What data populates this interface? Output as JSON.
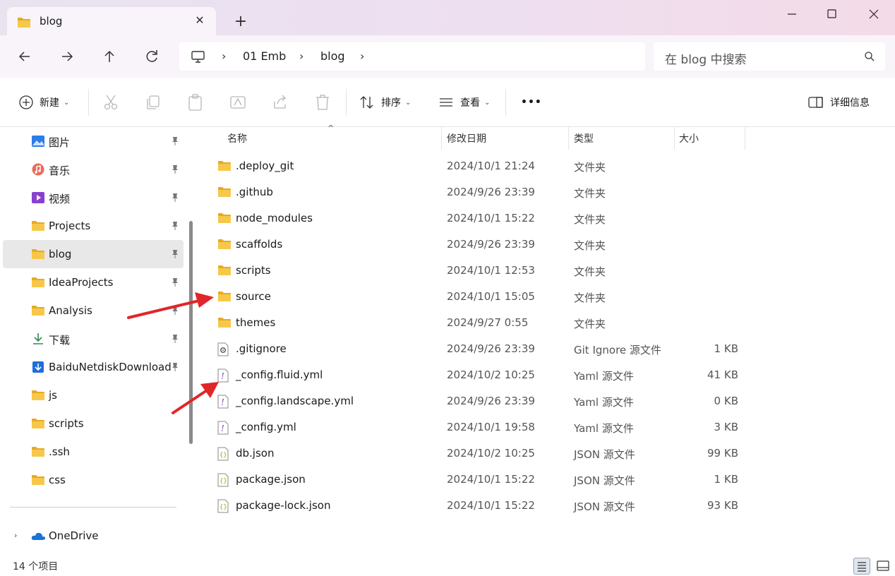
{
  "window": {
    "tab_title": "blog",
    "new_tab": "+",
    "minimize": "—",
    "maximize": "☐",
    "close": "✕"
  },
  "nav": {
    "breadcrumbs": [
      "01 Emb",
      "blog"
    ],
    "search_placeholder": "在 blog 中搜索"
  },
  "toolbar": {
    "new_label": "新建",
    "sort_label": "排序",
    "view_label": "查看",
    "more_label": "•••",
    "details_label": "详细信息"
  },
  "sidebar": {
    "items": [
      {
        "label": "图片",
        "icon": "pictures-icon",
        "pinned": true
      },
      {
        "label": "音乐",
        "icon": "music-icon",
        "pinned": true
      },
      {
        "label": "视频",
        "icon": "video-icon",
        "pinned": true
      },
      {
        "label": "Projects",
        "icon": "folder-icon",
        "pinned": true
      },
      {
        "label": "blog",
        "icon": "folder-icon",
        "pinned": true,
        "selected": true
      },
      {
        "label": "IdeaProjects",
        "icon": "folder-icon",
        "pinned": true
      },
      {
        "label": "Analysis",
        "icon": "folder-icon",
        "pinned": true
      },
      {
        "label": "下载",
        "icon": "download-icon",
        "pinned": true
      },
      {
        "label": "BaiduNetdiskDownload",
        "icon": "baidu-download-icon",
        "pinned": true
      },
      {
        "label": "js",
        "icon": "folder-icon",
        "pinned": false
      },
      {
        "label": "scripts",
        "icon": "folder-icon",
        "pinned": false
      },
      {
        "label": ".ssh",
        "icon": "folder-icon",
        "pinned": false
      },
      {
        "label": "css",
        "icon": "folder-icon",
        "pinned": false
      }
    ],
    "onedrive_label": "OneDrive"
  },
  "columns": {
    "name": "名称",
    "date": "修改日期",
    "type": "类型",
    "size": "大小"
  },
  "files": [
    {
      "name": ".deploy_git",
      "date": "2024/10/1 21:24",
      "type": "文件夹",
      "size": "",
      "icon": "folder-icon"
    },
    {
      "name": ".github",
      "date": "2024/9/26 23:39",
      "type": "文件夹",
      "size": "",
      "icon": "folder-icon"
    },
    {
      "name": "node_modules",
      "date": "2024/10/1 15:22",
      "type": "文件夹",
      "size": "",
      "icon": "folder-icon"
    },
    {
      "name": "scaffolds",
      "date": "2024/9/26 23:39",
      "type": "文件夹",
      "size": "",
      "icon": "folder-icon"
    },
    {
      "name": "scripts",
      "date": "2024/10/1 12:53",
      "type": "文件夹",
      "size": "",
      "icon": "folder-icon"
    },
    {
      "name": "source",
      "date": "2024/10/1 15:05",
      "type": "文件夹",
      "size": "",
      "icon": "folder-icon"
    },
    {
      "name": "themes",
      "date": "2024/9/27 0:55",
      "type": "文件夹",
      "size": "",
      "icon": "folder-icon"
    },
    {
      "name": ".gitignore",
      "date": "2024/9/26 23:39",
      "type": "Git Ignore 源文件",
      "size": "1 KB",
      "icon": "gear-file-icon"
    },
    {
      "name": "_config.fluid.yml",
      "date": "2024/10/2 10:25",
      "type": "Yaml 源文件",
      "size": "41 KB",
      "icon": "yaml-file-icon"
    },
    {
      "name": "_config.landscape.yml",
      "date": "2024/9/26 23:39",
      "type": "Yaml 源文件",
      "size": "0 KB",
      "icon": "yaml-file-icon"
    },
    {
      "name": "_config.yml",
      "date": "2024/10/1 19:58",
      "type": "Yaml 源文件",
      "size": "3 KB",
      "icon": "yaml-file-icon"
    },
    {
      "name": "db.json",
      "date": "2024/10/2 10:25",
      "type": "JSON 源文件",
      "size": "99 KB",
      "icon": "json-file-icon"
    },
    {
      "name": "package.json",
      "date": "2024/10/1 15:22",
      "type": "JSON 源文件",
      "size": "1 KB",
      "icon": "json-file-icon"
    },
    {
      "name": "package-lock.json",
      "date": "2024/10/1 15:22",
      "type": "JSON 源文件",
      "size": "93 KB",
      "icon": "json-file-icon"
    }
  ],
  "status": {
    "item_count": "14 个项目"
  },
  "colors": {
    "folder": "#f3c043",
    "annotation_arrow": "#e0262a",
    "selected_bg": "#e8e8e8"
  }
}
